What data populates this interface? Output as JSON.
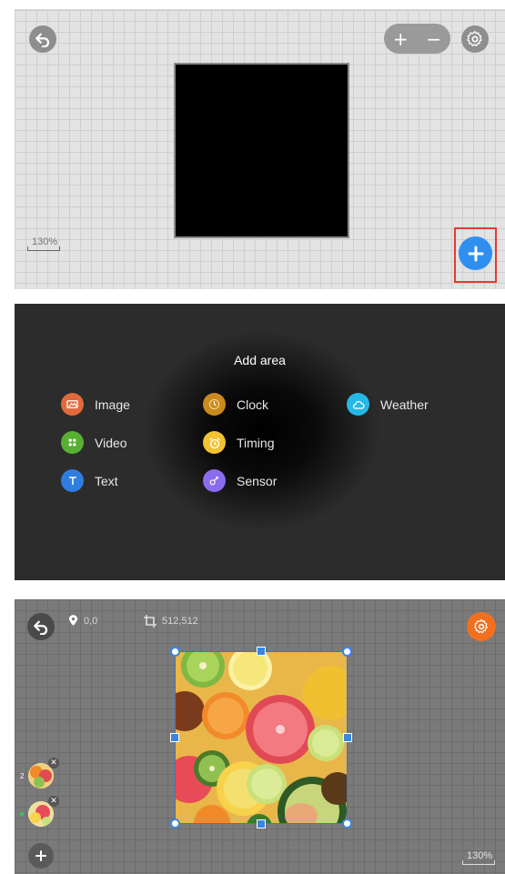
{
  "panel1": {
    "icons": {
      "back": "undo-arrow-icon",
      "settings": "gear-icon",
      "add": "plus-icon"
    },
    "zoom_in_label": "+",
    "zoom_out_label": "−",
    "scale_label": "130%",
    "colors": {
      "fab": "#2f8ff0",
      "highlight": "#e53935"
    }
  },
  "panel2": {
    "title": "Add area",
    "items": [
      {
        "label": "Image",
        "icon": "image-icon",
        "color": "#e06a3c"
      },
      {
        "label": "Clock",
        "icon": "clock-icon",
        "color": "#c98a1e"
      },
      {
        "label": "Weather",
        "icon": "weather-icon",
        "color": "#25b9e8"
      },
      {
        "label": "Video",
        "icon": "video-icon",
        "color": "#58b030"
      },
      {
        "label": "Timing",
        "icon": "timing-icon",
        "color": "#f1c232"
      },
      {
        "label": "Text",
        "icon": "text-icon",
        "color": "#2f7de1"
      },
      {
        "label": "Sensor",
        "icon": "sensor-icon",
        "color": "#8b6cf0"
      }
    ]
  },
  "panel3": {
    "position_readout": "0,0",
    "size_readout": "512,512",
    "scale_label": "130%",
    "layers": [
      {
        "number": "2",
        "icon": "fruit-image-thumbnail"
      },
      {
        "number": "",
        "icon": "fruit-image-thumbnail"
      }
    ],
    "colors": {
      "settings": "#f07020",
      "handles": "#3a86e0"
    }
  }
}
